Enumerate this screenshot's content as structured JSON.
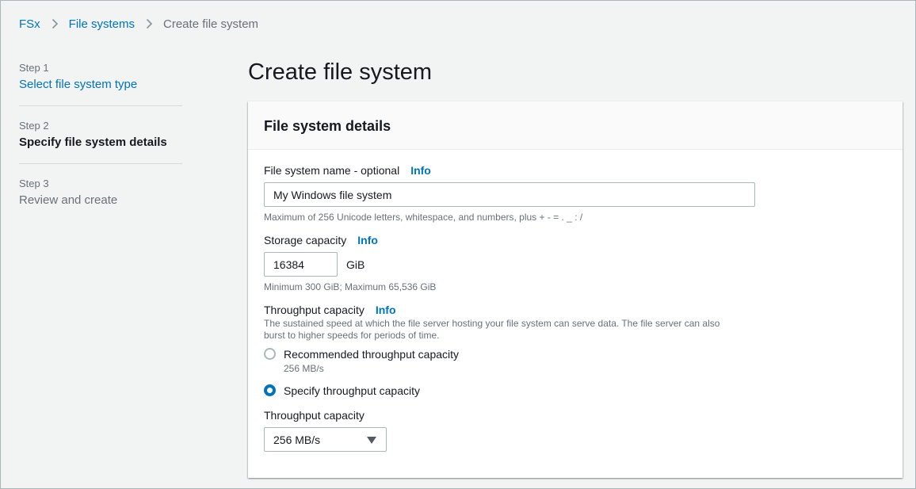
{
  "breadcrumb": {
    "items": [
      "FSx",
      "File systems"
    ],
    "current": "Create file system"
  },
  "steps": [
    {
      "num": "Step 1",
      "title": "Select file system type"
    },
    {
      "num": "Step 2",
      "title": "Specify file system details"
    },
    {
      "num": "Step 3",
      "title": "Review and create"
    }
  ],
  "page_title": "Create file system",
  "panel": {
    "title": "File system details",
    "info_label": "Info",
    "fs_name": {
      "label": "File system name - optional",
      "value": "My Windows file system",
      "hint": "Maximum of 256 Unicode letters, whitespace, and numbers, plus + - = . _ : /"
    },
    "storage": {
      "label": "Storage capacity",
      "value": "16384",
      "unit": "GiB",
      "hint": "Minimum 300 GiB; Maximum 65,536 GiB"
    },
    "throughput": {
      "label": "Throughput capacity",
      "desc_line1": "The sustained speed at which the file server hosting your file system can serve data. The file server can also",
      "desc_line2": "burst to higher speeds for periods of time.",
      "option_recommended": "Recommended throughput capacity",
      "option_recommended_sub": "256 MB/s",
      "option_specify": "Specify throughput capacity",
      "selected": "specify",
      "select_label": "Throughput capacity",
      "select_value": "256 MB/s"
    }
  },
  "colors": {
    "link": "#0073bb",
    "text": "#16191f",
    "muted": "#687078"
  }
}
